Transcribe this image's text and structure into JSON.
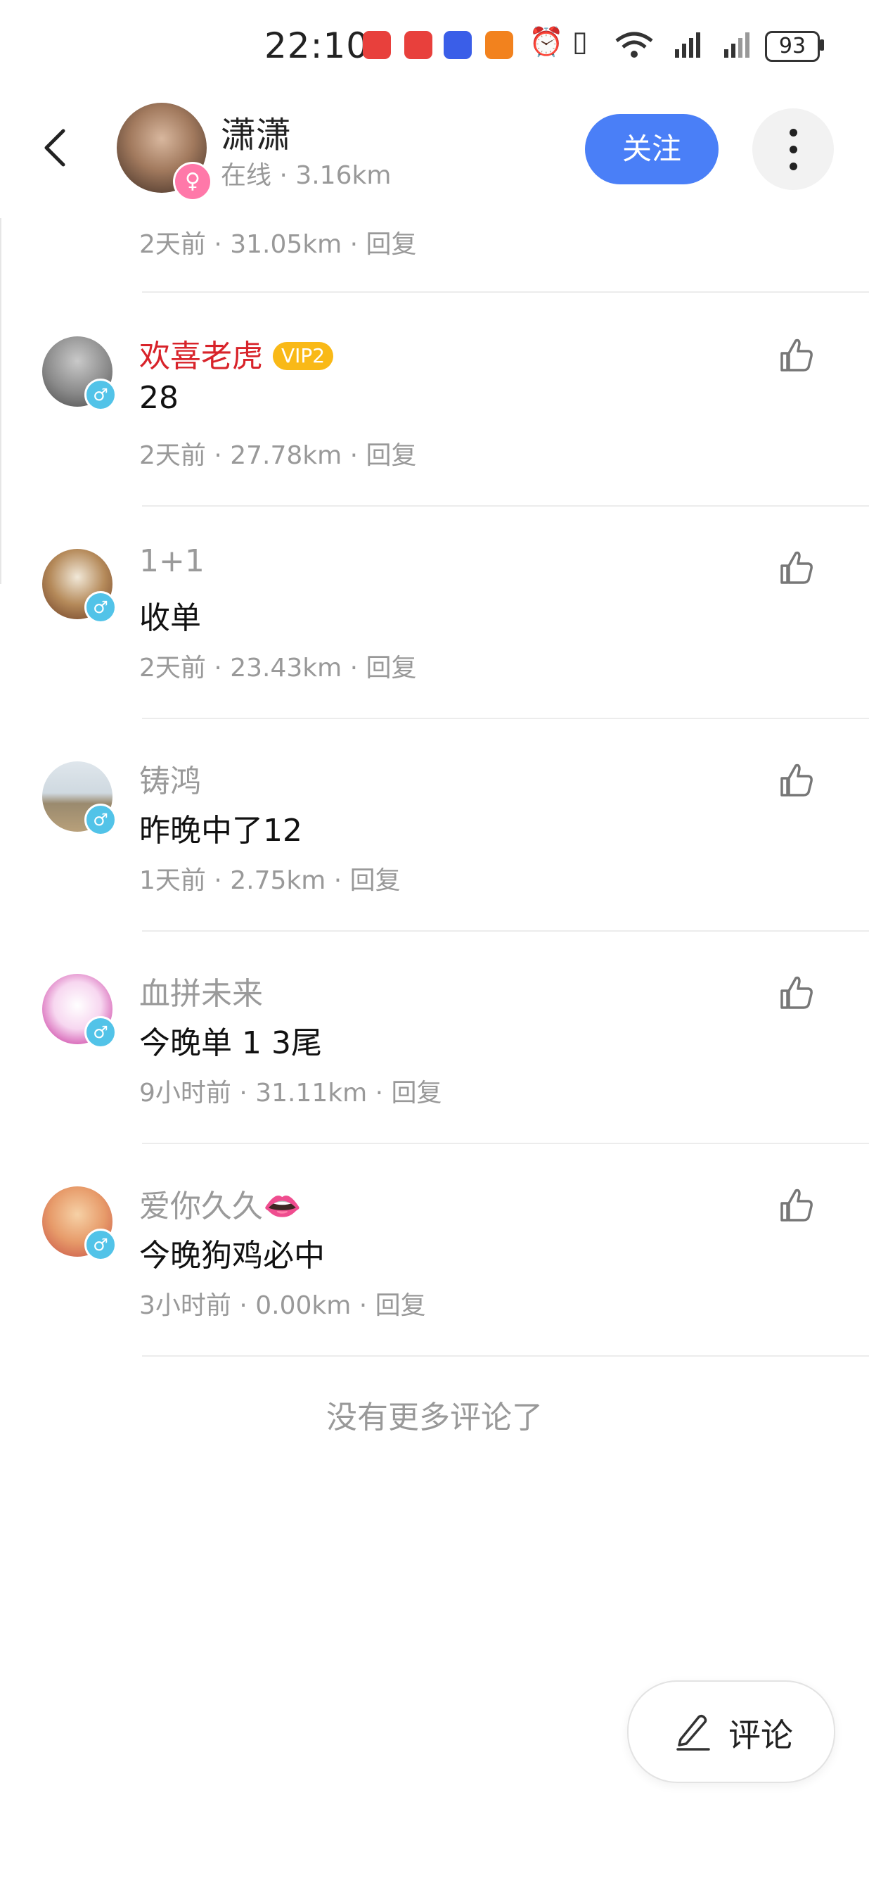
{
  "status_bar": {
    "time": "22:10",
    "battery": "93",
    "icons": [
      "huawei-app-icon",
      "huawei-app-icon",
      "chat-app-icon",
      "video-app-icon",
      "alarm-icon",
      "vibrate-icon",
      "wifi-icon",
      "5g-signal-icon",
      "4g-signal-icon",
      "battery-icon"
    ]
  },
  "header": {
    "name": "潇潇",
    "status": "在线",
    "distance": "3.16km",
    "sub_line": "在线 · 3.16km",
    "follow_label": "关注",
    "gender_symbol": "♀"
  },
  "partial_item": {
    "meta": "2天前 · 31.05km · 回复"
  },
  "comments": [
    {
      "name": "欢喜老虎",
      "vip": "VIP2",
      "text": "28",
      "meta": "2天前 · 27.78km · 回复",
      "gender": "♂"
    },
    {
      "name": "1+1",
      "vip": "",
      "text": "收单",
      "meta": "2天前 · 23.43km · 回复",
      "gender": "♂"
    },
    {
      "name": "铸鸿",
      "vip": "",
      "text": "昨晚中了12",
      "meta": "1天前 · 2.75km · 回复",
      "gender": "♂"
    },
    {
      "name": "血拼未来",
      "vip": "",
      "text": "今晚单 1 3尾",
      "meta": "9小时前 · 31.11km · 回复",
      "gender": "♂"
    },
    {
      "name": "爱你久久👄",
      "vip": "",
      "text": "今晚狗鸡必中",
      "meta": "3小时前 · 0.00km · 回复",
      "gender": "♂"
    }
  ],
  "footer": {
    "no_more": "没有更多评论了",
    "comment_label": "评论"
  },
  "colors": {
    "accent": "#4a7ff7",
    "vip_name": "#d8232a",
    "vip_badge": "#f9b917",
    "male": "#52c3e8",
    "female": "#ff78a9"
  }
}
